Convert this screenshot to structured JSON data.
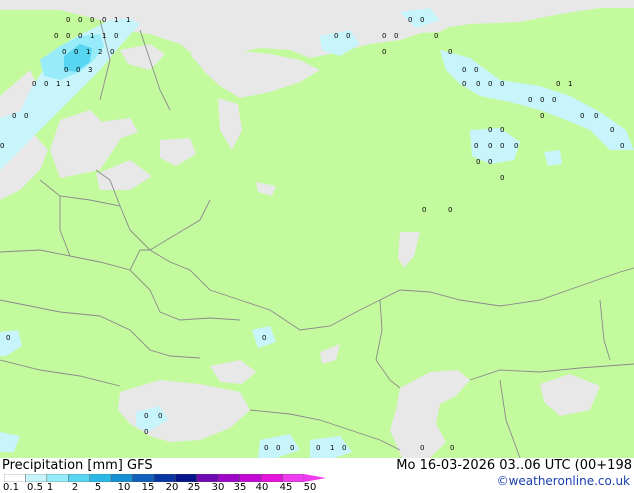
{
  "product": {
    "title": "Precipitation [mm]",
    "model": "GFS"
  },
  "valid_time": "Mo 16-03-2026 03..06 UTC (00+198",
  "credit": "©weatheronline.co.uk",
  "legend": {
    "labels": [
      "0.1",
      "0.5",
      "1",
      "2",
      "5",
      "10",
      "15",
      "20",
      "25",
      "30",
      "35",
      "40",
      "45",
      "50"
    ],
    "colors": [
      "#ffffff",
      "#c8f4fb",
      "#98ecf9",
      "#58d6f1",
      "#2cb8e6",
      "#1690d2",
      "#1060bc",
      "#0a36a4",
      "#06148a",
      "#700ab2",
      "#9e06c8",
      "#c40ad2",
      "#e412dc",
      "#f03cf0"
    ]
  },
  "map": {
    "land_color": "#c4fa9e",
    "water_color": "#e8e8e8",
    "precip_colors": {
      "light": "#c8f4fb",
      "medium": "#98ecf9",
      "heavy": "#58d6f1"
    }
  },
  "values": [
    "0",
    "0",
    "0",
    "0",
    "1",
    "1",
    "0",
    "0",
    "0",
    "1",
    "1",
    "0",
    "0",
    "0",
    "1",
    "2",
    "0",
    "0",
    "0",
    "3",
    "0",
    "0",
    "1",
    "1",
    "0",
    "0",
    "0",
    "0",
    "0",
    "0",
    "0",
    "0",
    "0",
    "0",
    "0",
    "0",
    "0",
    "0",
    "0",
    "0",
    "0",
    "0",
    "0",
    "1",
    "0",
    "0",
    "0",
    "0",
    "0",
    "0",
    "0",
    "0",
    "0",
    "0",
    "0",
    "0",
    "0",
    "0",
    "0",
    "0",
    "0",
    "0",
    "0",
    "0",
    "0",
    "0",
    "0",
    "0",
    "0",
    "0",
    "0",
    "0",
    "1",
    "0",
    "0",
    "0"
  ]
}
